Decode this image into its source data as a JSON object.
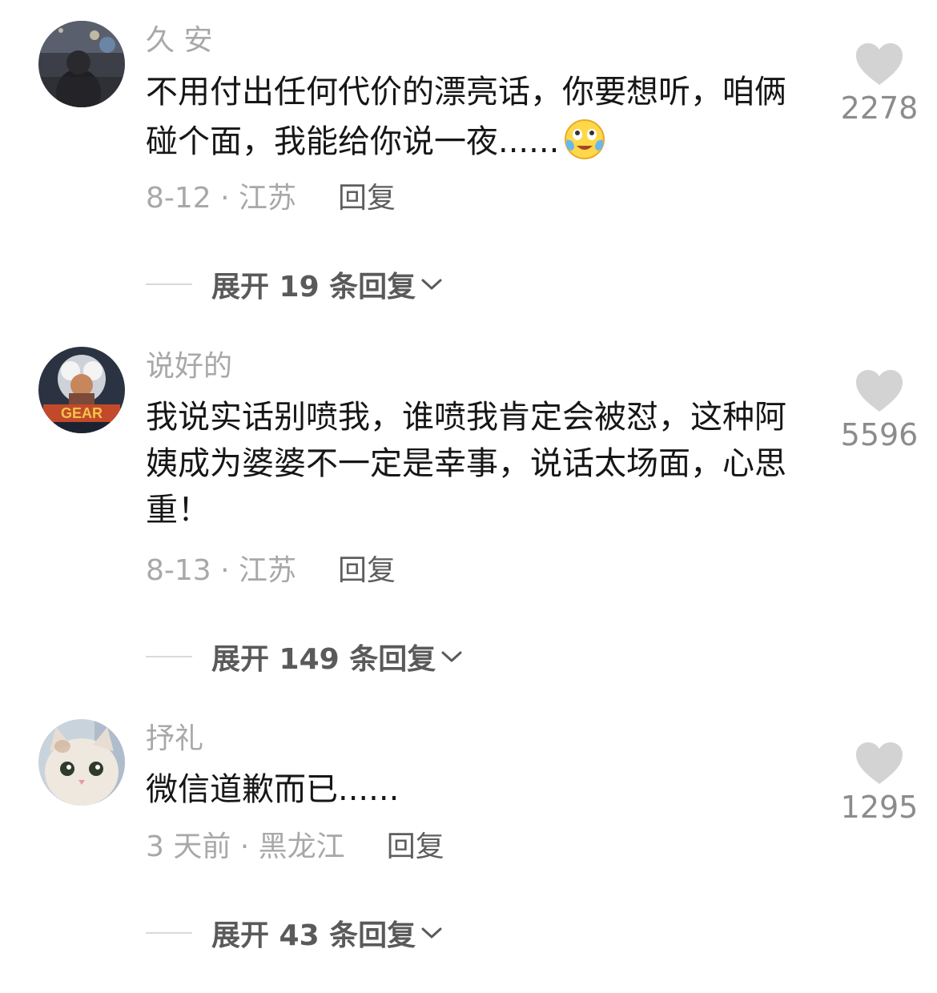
{
  "comments": [
    {
      "username": "久 安",
      "text": "不用付出任何代价的漂亮话，你要想听，咱俩碰个面，我能给你说一夜......",
      "date_location": "8-12 · 江苏",
      "reply_label": "回复",
      "likes": "2278",
      "expand_label": "展开 19 条回复",
      "emoji": "laughing-crying-emoji"
    },
    {
      "username": "说好的",
      "text": "我说实话别喷我，谁喷我肯定会被怼，这种阿姨成为婆婆不一定是幸事，说话太场面，心思重！",
      "date_location": "8-13 · 江苏",
      "reply_label": "回复",
      "likes": "5596",
      "expand_label": "展开 149 条回复"
    },
    {
      "username": "抒礼",
      "text": "微信道歉而已......",
      "date_location": "3 天前 · 黑龙江",
      "reply_label": "回复",
      "likes": "1295",
      "expand_label": "展开 43 条回复"
    }
  ],
  "colors": {
    "username": "#a8a8a8",
    "text": "#161616",
    "like_icon": "#d3d3d3",
    "reply": "#5e5e5e"
  }
}
